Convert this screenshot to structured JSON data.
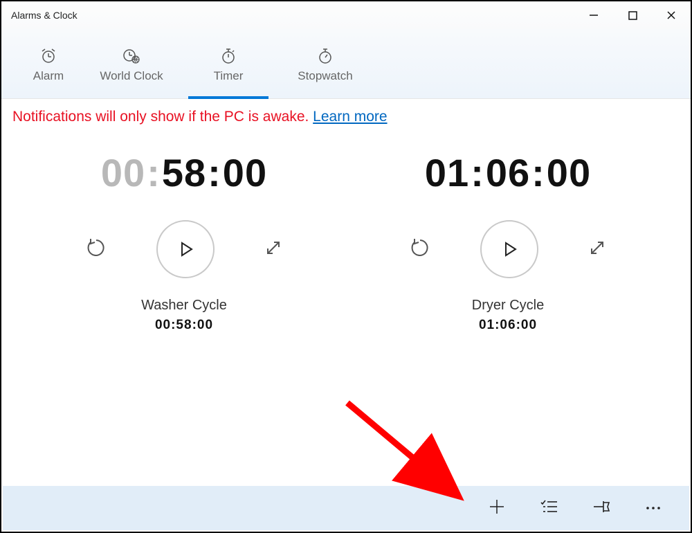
{
  "window": {
    "title": "Alarms & Clock"
  },
  "tabs": {
    "alarm": "Alarm",
    "worldclock": "World Clock",
    "timer": "Timer",
    "stopwatch": "Stopwatch"
  },
  "notice": {
    "text": "Notifications will only show if the PC is awake. ",
    "link": "Learn more"
  },
  "timers": [
    {
      "display_dim": "00",
      "display_min": "58",
      "display_sec": "00",
      "name": "Washer Cycle",
      "sub": "00:58:00"
    },
    {
      "display_hr": "01",
      "display_min": "06",
      "display_sec": "00",
      "name": "Dryer Cycle",
      "sub": "01:06:00"
    }
  ]
}
